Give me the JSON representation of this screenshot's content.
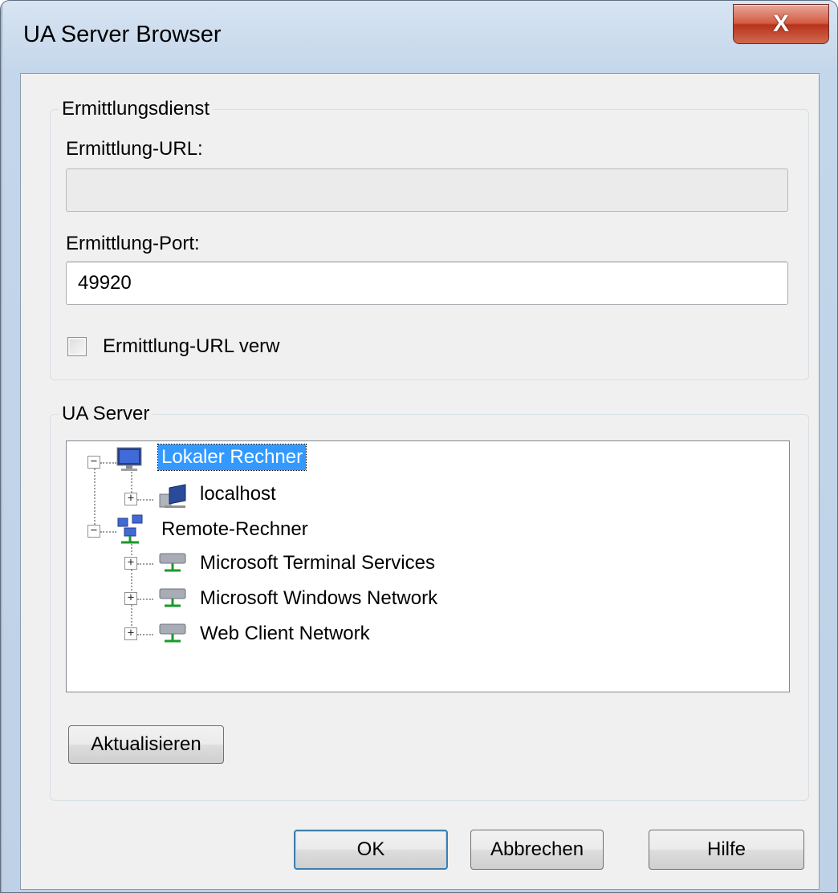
{
  "window": {
    "title": "UA Server Browser",
    "close_label": "X"
  },
  "discovery": {
    "legend": "Ermittlungsdienst",
    "url_label": "Ermittlung-URL:",
    "url_value": "",
    "port_label": "Ermittlung-Port:",
    "port_value": "49920",
    "use_url_checkbox_label": "Ermittlung-URL verw",
    "use_url_checked": false
  },
  "servers": {
    "legend": "UA Server",
    "tree": {
      "local": {
        "label": "Lokaler Rechner",
        "expanded": true,
        "selected": true
      },
      "localhost": {
        "label": "localhost",
        "expanded": false
      },
      "remote": {
        "label": "Remote-Rechner",
        "expanded": true
      },
      "remote_children": [
        {
          "label": "Microsoft Terminal Services",
          "expanded": false
        },
        {
          "label": "Microsoft Windows Network",
          "expanded": false
        },
        {
          "label": "Web Client Network",
          "expanded": false
        }
      ]
    },
    "refresh_label": "Aktualisieren"
  },
  "footer": {
    "ok_label": "OK",
    "cancel_label": "Abbrechen",
    "help_label": "Hilfe"
  },
  "icons": {
    "expanded": "minus",
    "collapsed": "plus",
    "local_computer": "computer-monitor-icon",
    "network_computer": "network-computer-icon",
    "remote_network": "remote-network-icon",
    "network_share": "network-provider-icon"
  },
  "colors": {
    "selection": "#3399ff",
    "close_button": "#c8472e",
    "default_button_border": "#3c7fb1"
  }
}
